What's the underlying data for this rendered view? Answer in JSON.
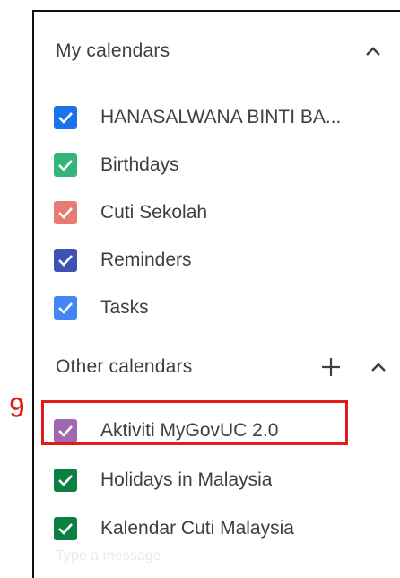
{
  "my_calendars": {
    "title": "My calendars",
    "items": [
      {
        "label": "HANASALWANA BINTI BA...",
        "color": "#1a73e8",
        "checked": true
      },
      {
        "label": "Birthdays",
        "color": "#33b679",
        "checked": true
      },
      {
        "label": "Cuti Sekolah",
        "color": "#e67c73",
        "checked": true
      },
      {
        "label": "Reminders",
        "color": "#3f51b5",
        "checked": true
      },
      {
        "label": "Tasks",
        "color": "#4285f4",
        "checked": true
      }
    ]
  },
  "other_calendars": {
    "title": "Other calendars",
    "items": [
      {
        "label": "Aktiviti MyGovUC 2.0",
        "color": "#9e69af",
        "checked": true
      },
      {
        "label": "Holidays in Malaysia",
        "color": "#0b8043",
        "checked": true
      },
      {
        "label": "Kalendar Cuti Malaysia",
        "color": "#0b8043",
        "checked": true
      }
    ]
  },
  "annotation": {
    "step_number": "9",
    "highlight_color": "#e31b1b"
  },
  "faded_placeholder": "Type a message",
  "icons": {
    "collapse": "chevron-up-icon",
    "add": "plus-icon",
    "check": "check-icon"
  }
}
